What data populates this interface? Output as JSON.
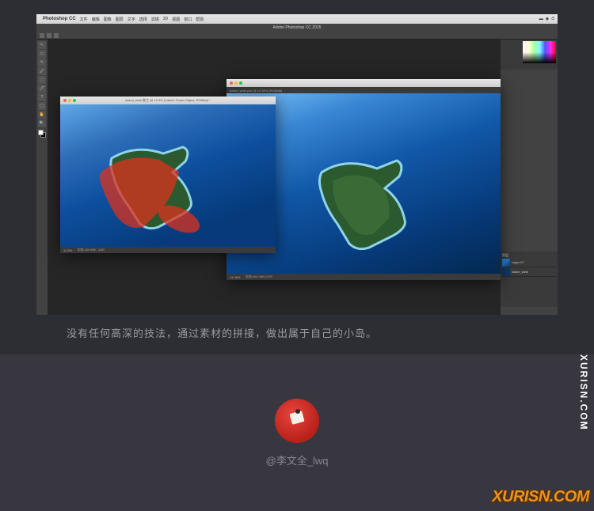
{
  "mac_menu": {
    "apple": "",
    "app": "Photoshop CC",
    "items": [
      "文件",
      "编辑",
      "图像",
      "图层",
      "文字",
      "选择",
      "滤镜",
      "3D",
      "视图",
      "窗口",
      "帮助"
    ],
    "right": [
      "🔋",
      "📶",
      "🔊",
      "⏰"
    ]
  },
  "ps": {
    "title": "Adobe Photoshop CC 2015",
    "tools": [
      "↖",
      "▭",
      "✎",
      "🖌",
      "⬚",
      "🖊",
      "T",
      "◯",
      "✋",
      "🔍"
    ],
    "layers_title": "图层",
    "layer1": "Layer 07",
    "layer2": "island_wide"
  },
  "doc1": {
    "title": "island_wide 能工 @ 12.5% (Interior Smart Object, RGB/8#) *",
    "zoom": "12.5%",
    "info": "文档:180.6M/...18G"
  },
  "doc2": {
    "tab": "island_wide.psd @ 14.36% (RGB/8#)",
    "zoom": "14.36%",
    "info": "文档:100.4M/1.07G"
  },
  "caption": "没有任何高深的技法，通过素材的拼接，做出属于自己的小岛。",
  "author": "@李文全_lwq",
  "watermark": "XURISN.COM",
  "watermark2": "XURISN.COM"
}
